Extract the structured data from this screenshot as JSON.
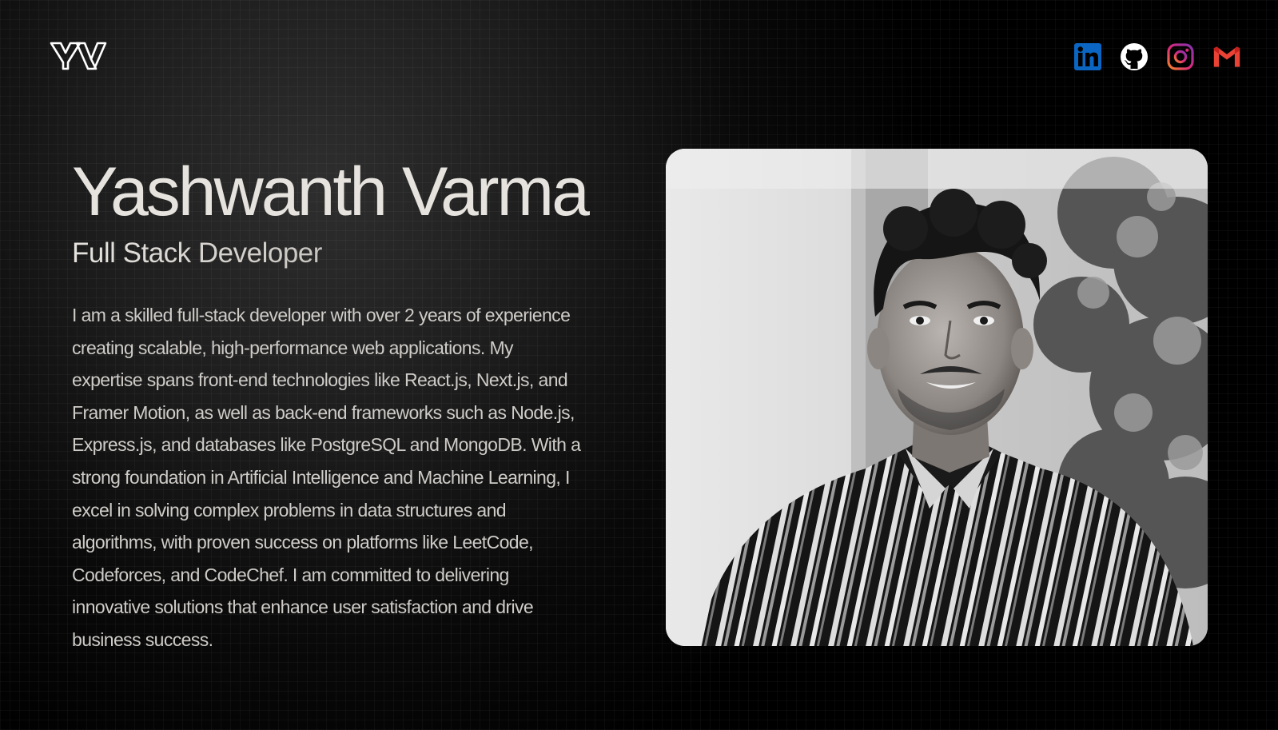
{
  "header": {
    "logo_text": "YV",
    "social_icons": [
      "linkedin-icon",
      "github-icon",
      "instagram-icon",
      "gmail-icon"
    ]
  },
  "hero": {
    "name": "Yashwanth Varma",
    "role": "Full Stack Developer",
    "bio": "I am a skilled full-stack developer with over 2 years of experience creating scalable, high-performance web applications. My expertise spans front-end technologies like React.js, Next.js, and Framer Motion, as well as back-end frameworks such as Node.js, Express.js, and databases like PostgreSQL and MongoDB. With a strong foundation in Artificial Intelligence and Machine Learning, I excel in solving complex problems in data structures and algorithms, with proven success on platforms like LeetCode, Codeforces, and CodeChef. I am committed to delivering innovative solutions that enhance user satisfaction and drive business success."
  },
  "colors": {
    "background": "#000000",
    "name_text": "#e6e3df",
    "body_text": "#cfccc8",
    "linkedin": "#0a66c2",
    "github": "#ffffff",
    "instagram": "#e1306c",
    "gmail": "#ea4335"
  }
}
